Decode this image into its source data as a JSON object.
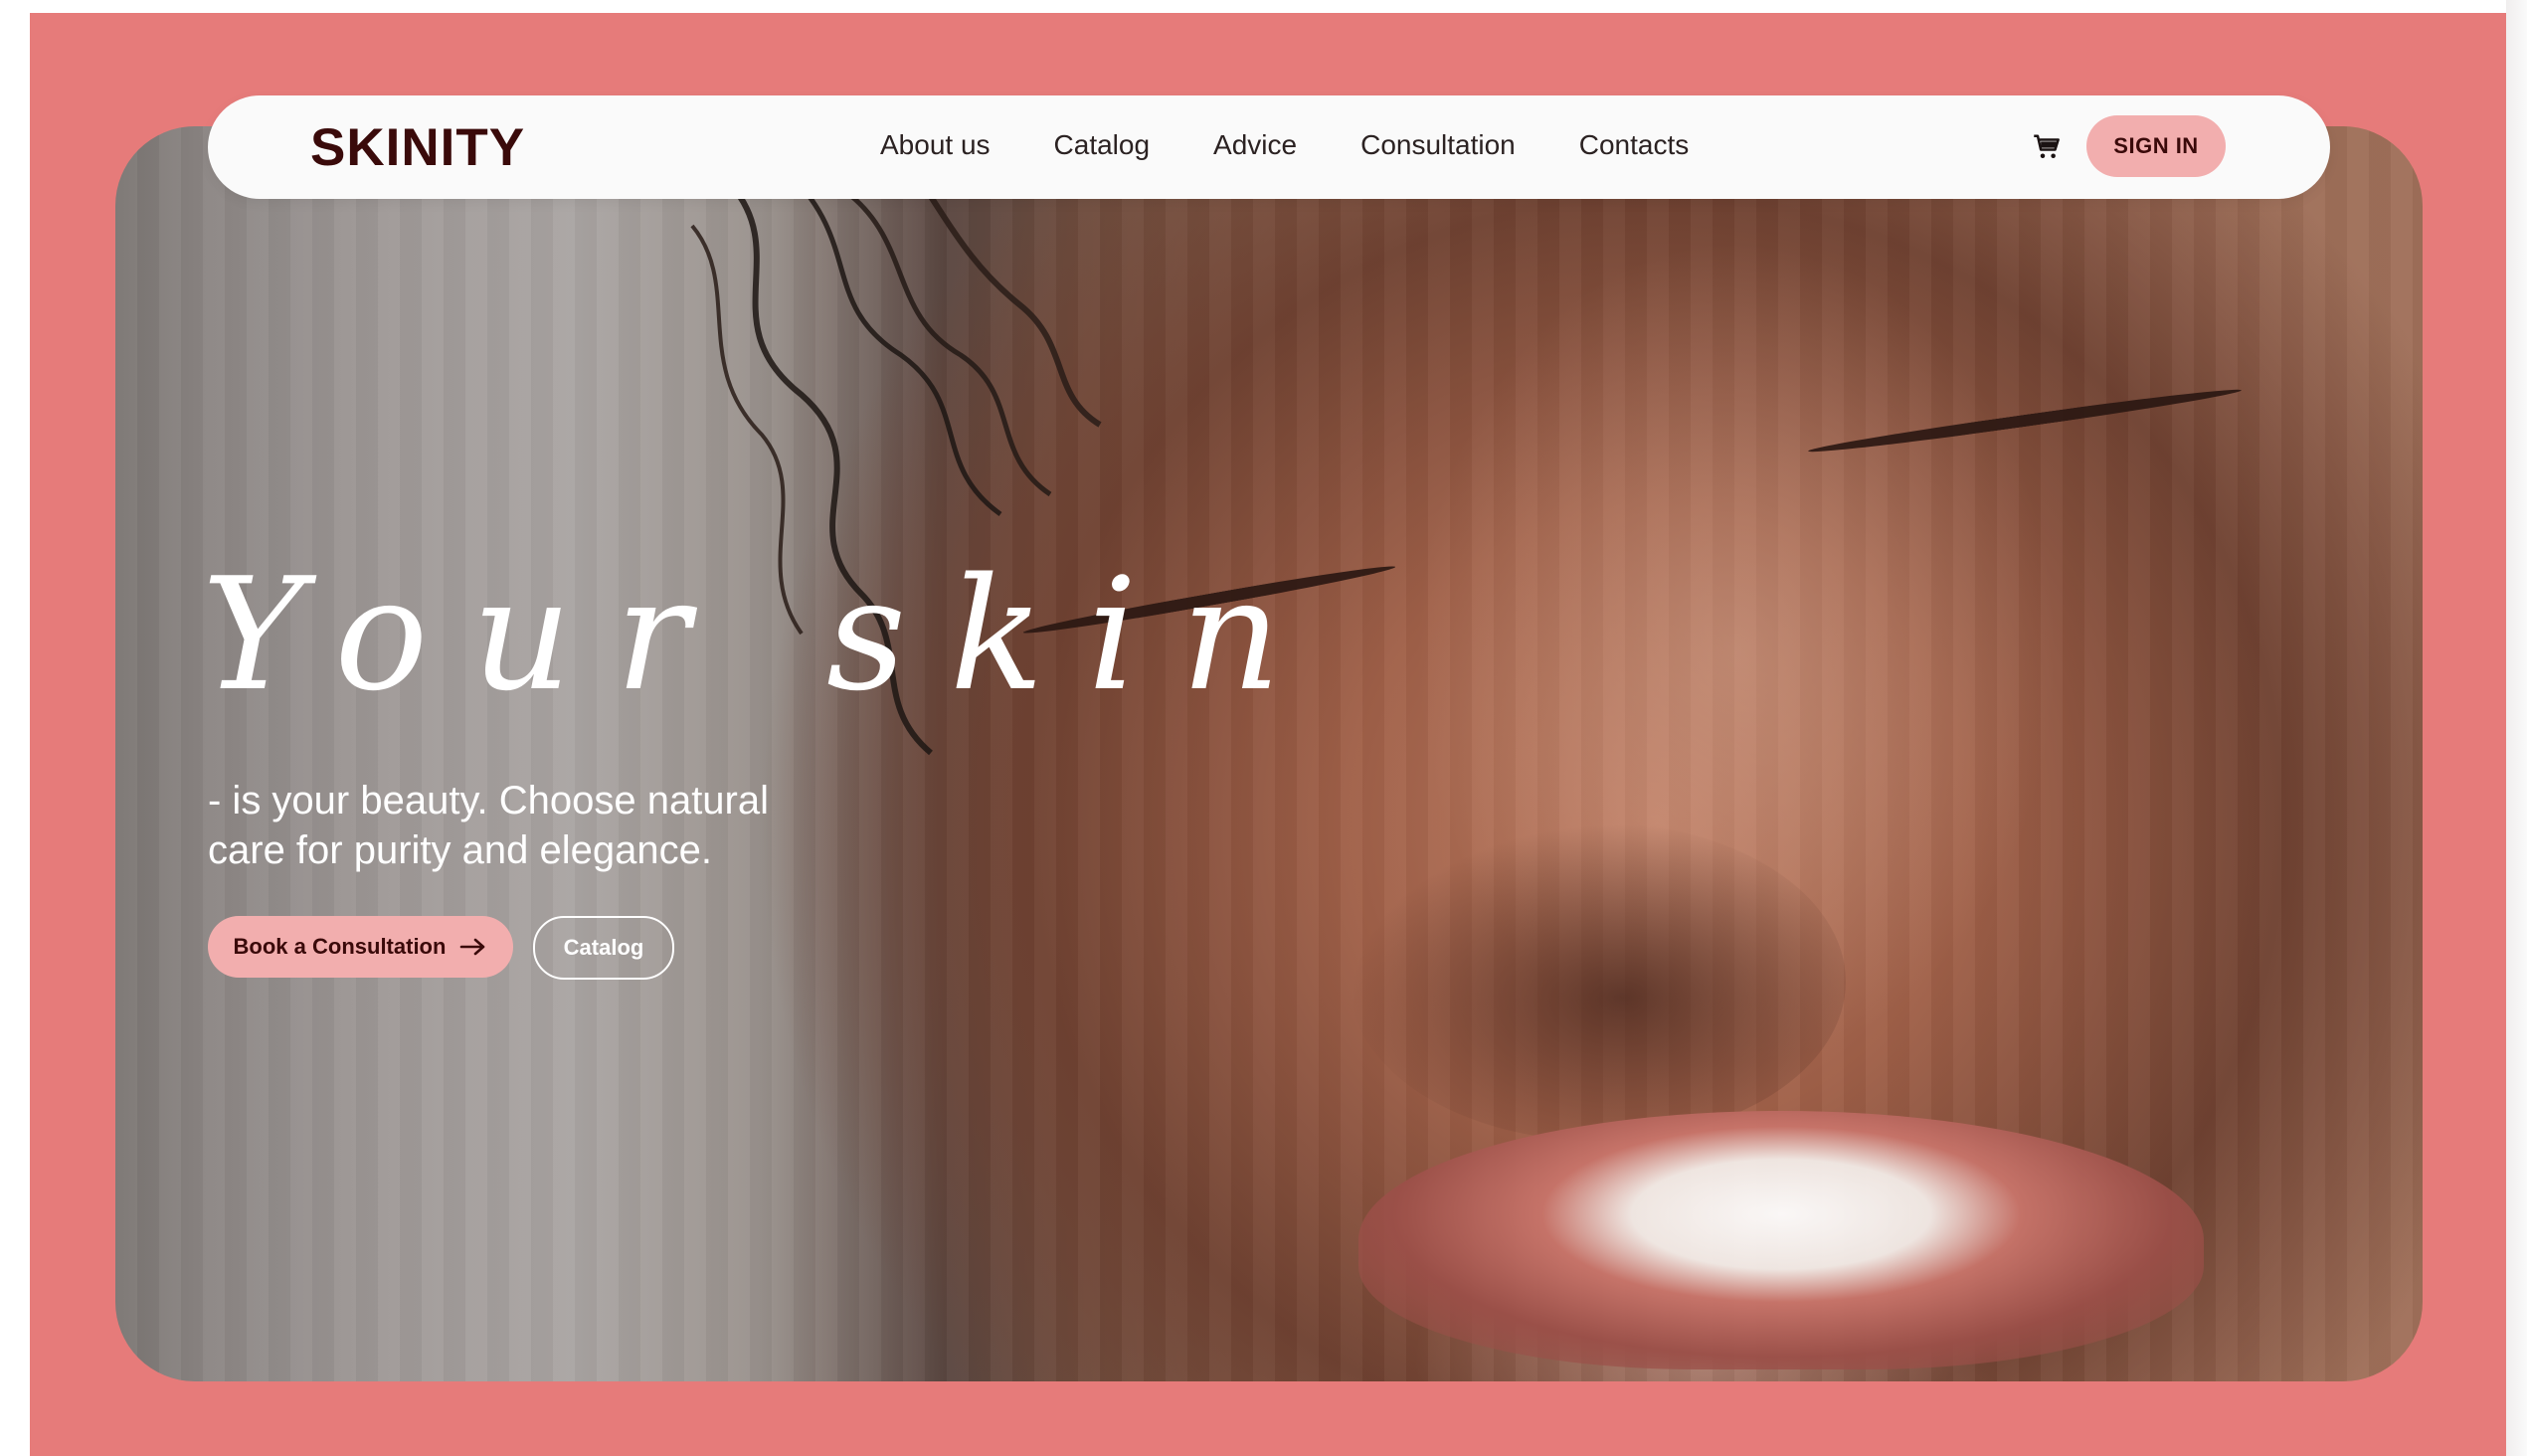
{
  "header": {
    "logo": "SKINITY",
    "nav": [
      {
        "label": "About us"
      },
      {
        "label": "Catalog"
      },
      {
        "label": "Advice"
      },
      {
        "label": "Consultation"
      },
      {
        "label": "Contacts"
      }
    ],
    "cart_icon": "cart-icon",
    "signin_label": "SIGN IN"
  },
  "hero": {
    "title": "Your skin",
    "subtitle_line1": "- is your beauty. Choose natural",
    "subtitle_line2": "care for purity and elegance.",
    "primary_button": "Book a Consultation",
    "primary_button_icon": "arrow-right-icon",
    "secondary_button": "Catalog"
  },
  "colors": {
    "background": "#e67b7a",
    "accent": "#f2aeae",
    "brand_text": "#3a0a0a",
    "nav_bg": "#fafafa"
  }
}
